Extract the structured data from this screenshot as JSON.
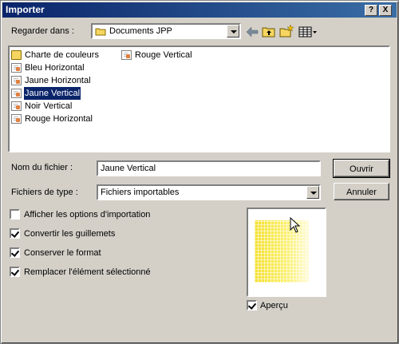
{
  "window": {
    "title": "Importer",
    "help_label": "?",
    "close_label": "X"
  },
  "lookin": {
    "label": "Regarder dans :",
    "value": "Documents JPP"
  },
  "files": [
    {
      "name": "Charte de couleurs",
      "type": "folder"
    },
    {
      "name": "Bleu Horizontal",
      "type": "doc"
    },
    {
      "name": "Jaune Horizontal",
      "type": "doc"
    },
    {
      "name": "Jaune Vertical",
      "type": "doc",
      "selected": true
    },
    {
      "name": "Noir Vertical",
      "type": "doc"
    },
    {
      "name": "Rouge Horizontal",
      "type": "doc"
    },
    {
      "name": "Rouge Vertical",
      "type": "doc"
    }
  ],
  "filename": {
    "label": "Nom du fichier :",
    "value": "Jaune Vertical"
  },
  "filetype": {
    "label": "Fichiers de type :",
    "value": "Fichiers importables"
  },
  "buttons": {
    "open": "Ouvrir",
    "cancel": "Annuler"
  },
  "options": [
    {
      "label": "Afficher les options d'importation",
      "checked": false
    },
    {
      "label": "Convertir les guillemets",
      "checked": true
    },
    {
      "label": "Conserver le format",
      "checked": true
    },
    {
      "label": "Remplacer l'élément sélectionné",
      "checked": true
    }
  ],
  "preview": {
    "label": "Aperçu",
    "checked": true,
    "swatch_color": "#f5e030"
  },
  "colors": {
    "titlebar": "#0a246a",
    "face": "#d4d0c8",
    "selection": "#0a246a"
  },
  "icons": [
    "back-arrow-icon",
    "up-folder-icon",
    "new-folder-icon",
    "view-menu-icon",
    "folder-icon",
    "document-icon",
    "mouse-cursor-icon"
  ]
}
